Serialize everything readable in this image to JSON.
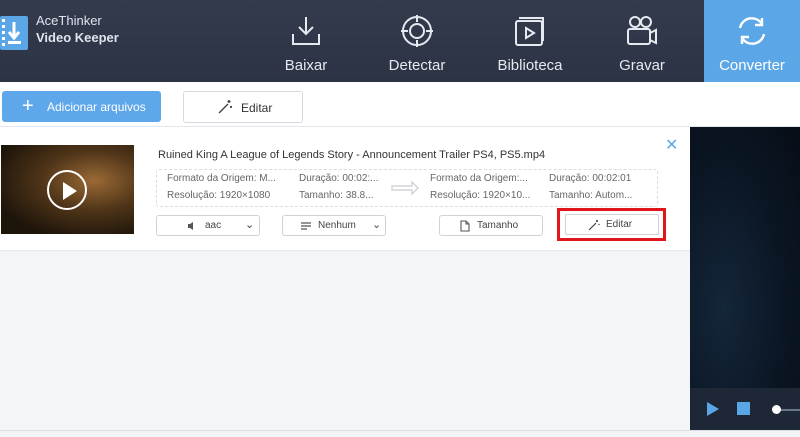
{
  "app": {
    "name_line1": "AceThinker",
    "name_line2": "Video Keeper"
  },
  "nav": [
    {
      "label": "Baixar",
      "icon": "download-icon"
    },
    {
      "label": "Detectar",
      "icon": "target-icon"
    },
    {
      "label": "Biblioteca",
      "icon": "library-icon"
    },
    {
      "label": "Gravar",
      "icon": "camera-icon"
    },
    {
      "label": "Converter",
      "icon": "convert-icon",
      "active": true
    }
  ],
  "toolbar": {
    "add_label": "Adicionar arquivos",
    "edit_label": "Editar"
  },
  "file": {
    "title": "Ruined King A League of Legends Story - Announcement Trailer  PS4, PS5.mp4",
    "src_format": "Formato da Origem: M...",
    "src_resolution": "Resolução: 1920×1080",
    "src_duration": "Duração:  00:02:...",
    "src_size": "Tamanho:  38.8...",
    "out_format": "Formato da Origem:...",
    "out_resolution": "Resolução:  1920×10...",
    "out_duration": "Duração:  00:02:01",
    "out_size": "Tamanho:  Autom...",
    "audio": "aac",
    "subtitle": "Nenhum",
    "size_btn": "Tamanho",
    "edit_btn": "Editar"
  },
  "colors": {
    "accent": "#5ba6e6",
    "highlight": "#e0161d",
    "topbar": "#2f3748"
  }
}
